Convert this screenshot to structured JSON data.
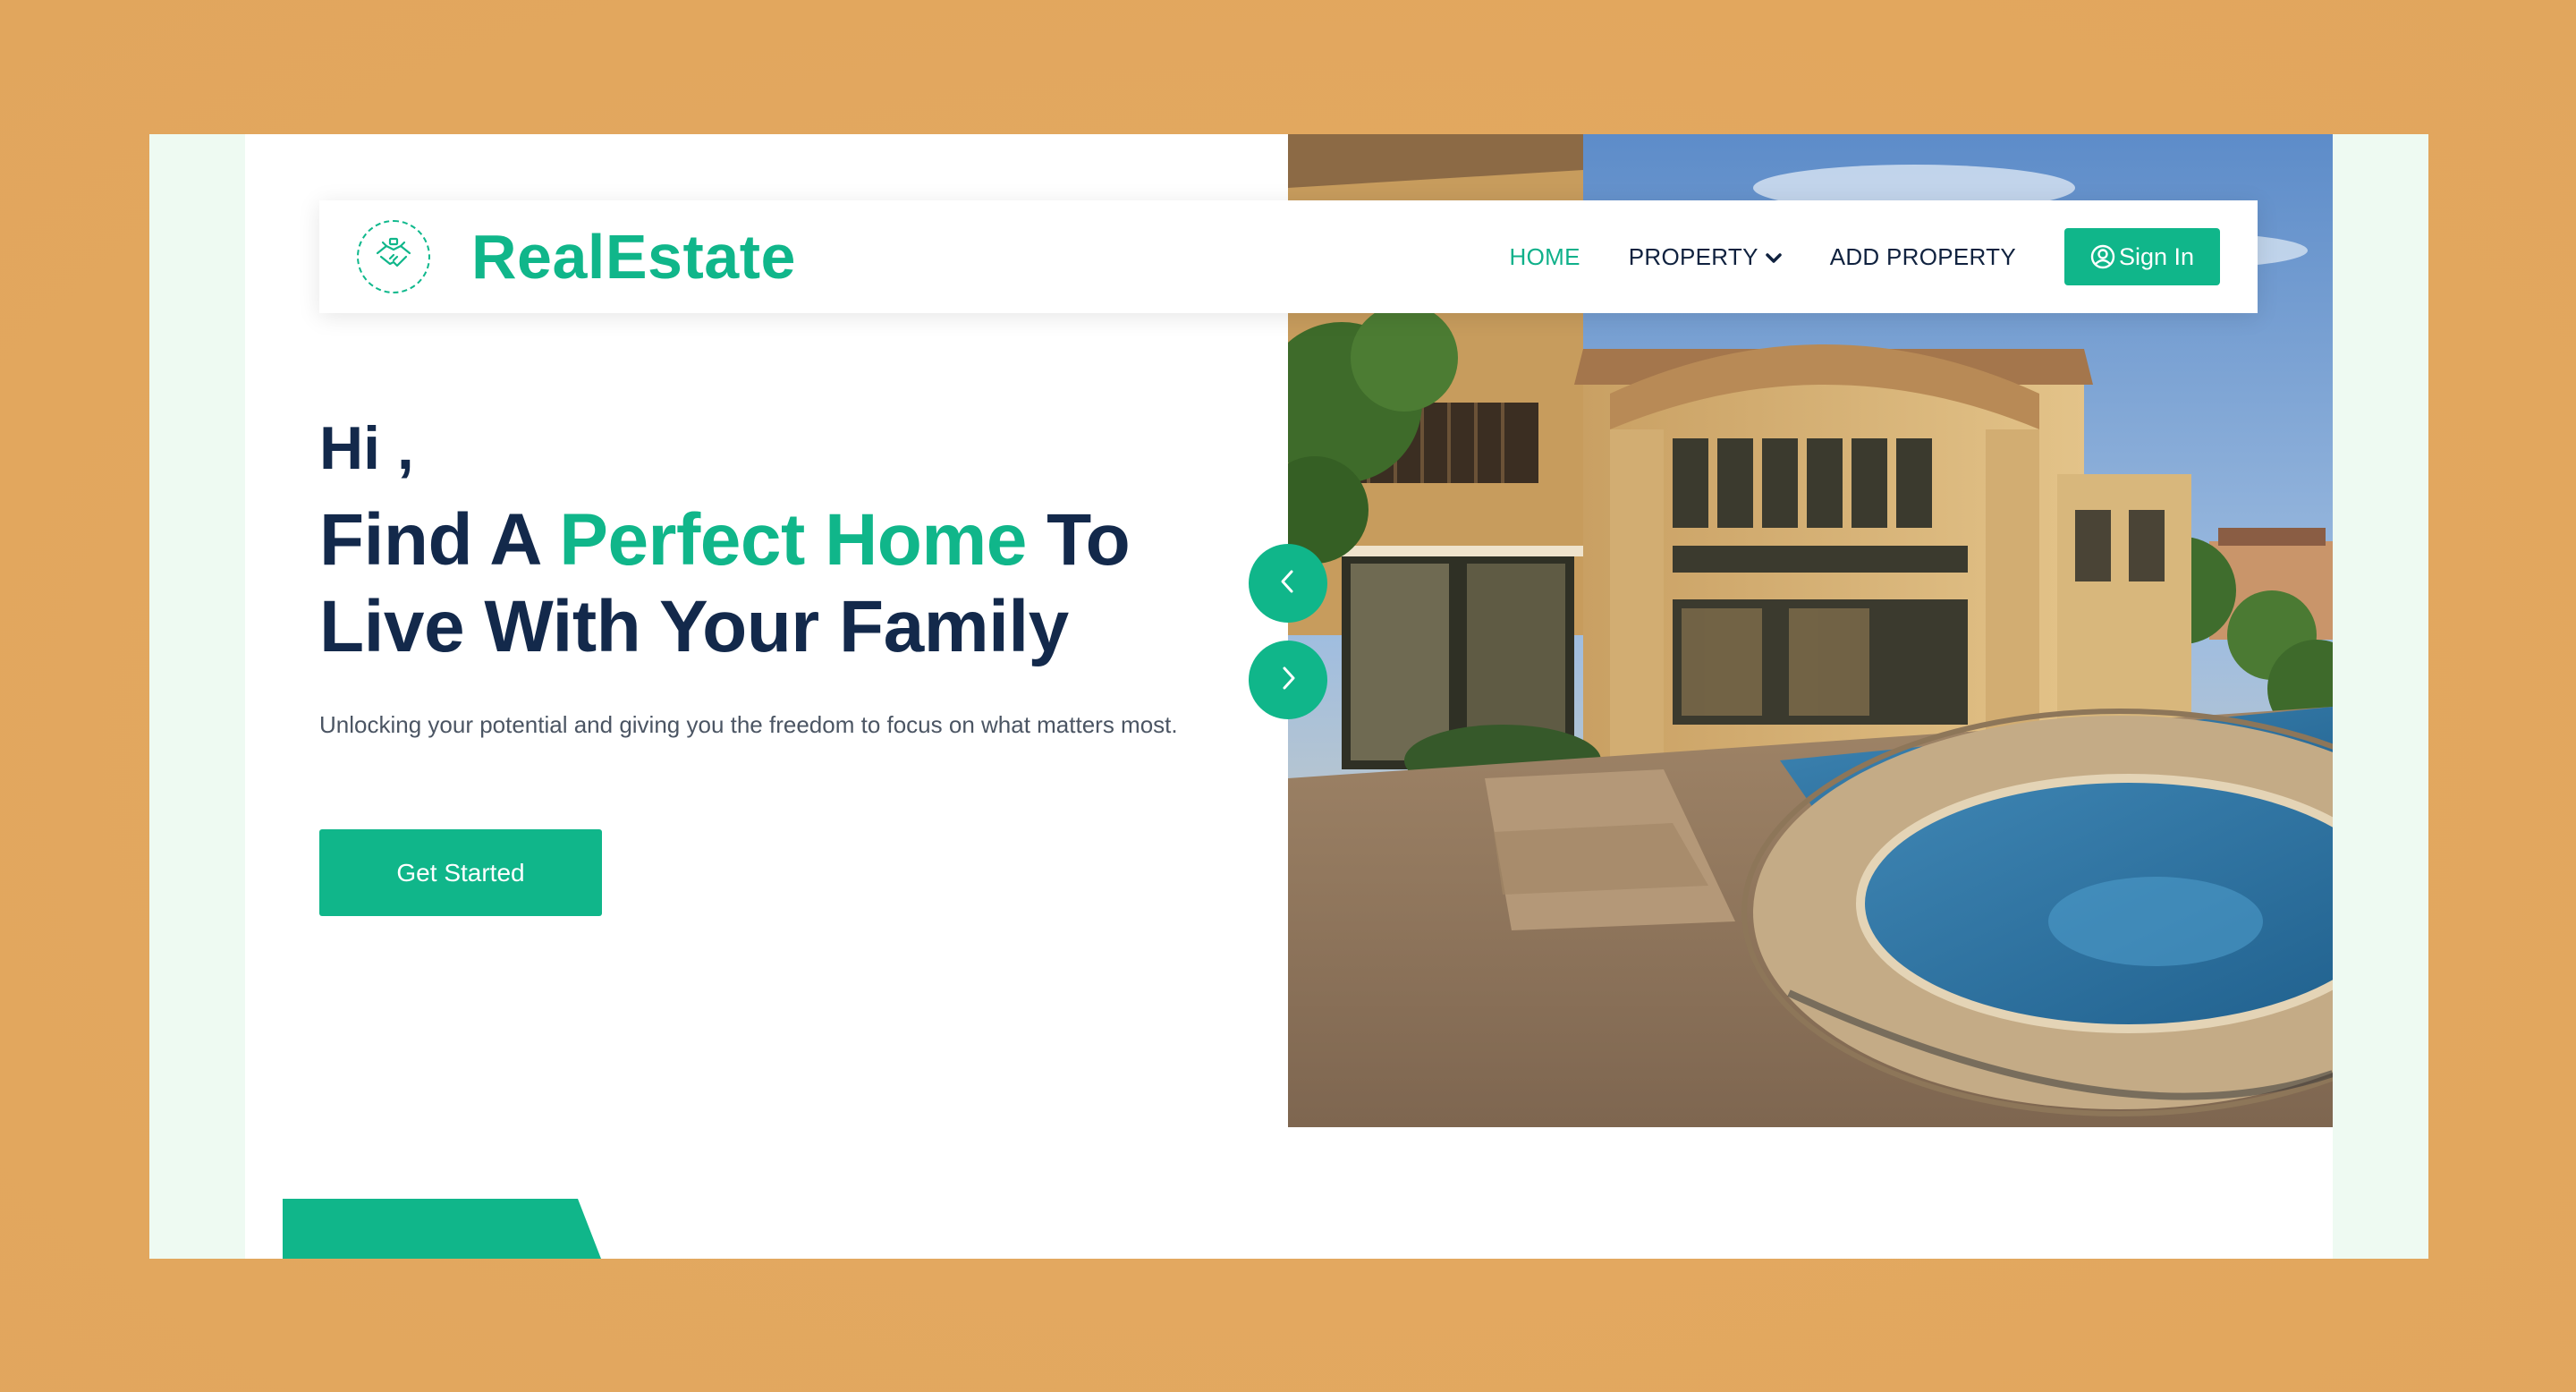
{
  "brand": {
    "name": "RealEstate",
    "logo_icon": "handshake-icon"
  },
  "nav": {
    "links": [
      {
        "label": "HOME",
        "active": true
      },
      {
        "label": "PROPERTY",
        "has_dropdown": true
      },
      {
        "label": "ADD PROPERTY"
      }
    ],
    "signin_label": "Sign In",
    "signin_icon": "user-circle-icon"
  },
  "hero": {
    "greeting": "Hi ,",
    "headline_part1": "Find A ",
    "headline_accent": "Perfect Home",
    "headline_part2": " To Live With Your Family",
    "subtext": "Unlocking your potential and giving you the freedom to focus on what matters most.",
    "cta_label": "Get Started",
    "image": "luxury-house-with-pool-photo"
  },
  "carousel": {
    "prev_icon": "chevron-left-icon",
    "next_icon": "chevron-right-icon"
  },
  "colors": {
    "accent": "#10b68a",
    "heading": "#13294b",
    "background": "#e3a860",
    "frame": "#eefaf2"
  }
}
